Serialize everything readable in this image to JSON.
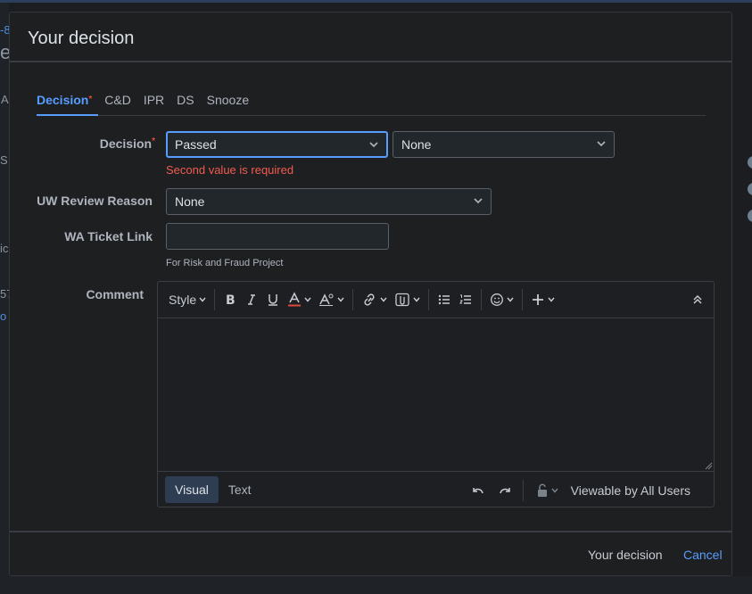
{
  "background": {
    "fragments": [
      "-8",
      "e",
      "A",
      "S",
      "ic",
      "57",
      "o"
    ]
  },
  "dialog": {
    "title": "Your decision",
    "tabs": [
      {
        "label": "Decision",
        "required": "*"
      },
      {
        "label": "C&D"
      },
      {
        "label": "IPR"
      },
      {
        "label": "DS"
      },
      {
        "label": "Snooze"
      }
    ],
    "fields": {
      "decision": {
        "label": "Decision",
        "required_mark": "*",
        "primary_value": "Passed",
        "secondary_value": "None",
        "error": "Second value is required"
      },
      "uw_review_reason": {
        "label": "UW Review Reason",
        "value": "None"
      },
      "wa_ticket_link": {
        "label": "WA Ticket Link",
        "value": "",
        "hint": "For Risk and Fraud Project"
      },
      "comment": {
        "label": "Comment"
      }
    },
    "editor": {
      "style_label": "Style",
      "modes": [
        "Visual",
        "Text"
      ],
      "visibility": "Viewable by All Users"
    },
    "footer": {
      "submit_label": "Your decision",
      "cancel_label": "Cancel"
    }
  },
  "colors": {
    "accent": "#579dff",
    "error": "#f15b50",
    "text_color_underline": "#e2483d"
  }
}
